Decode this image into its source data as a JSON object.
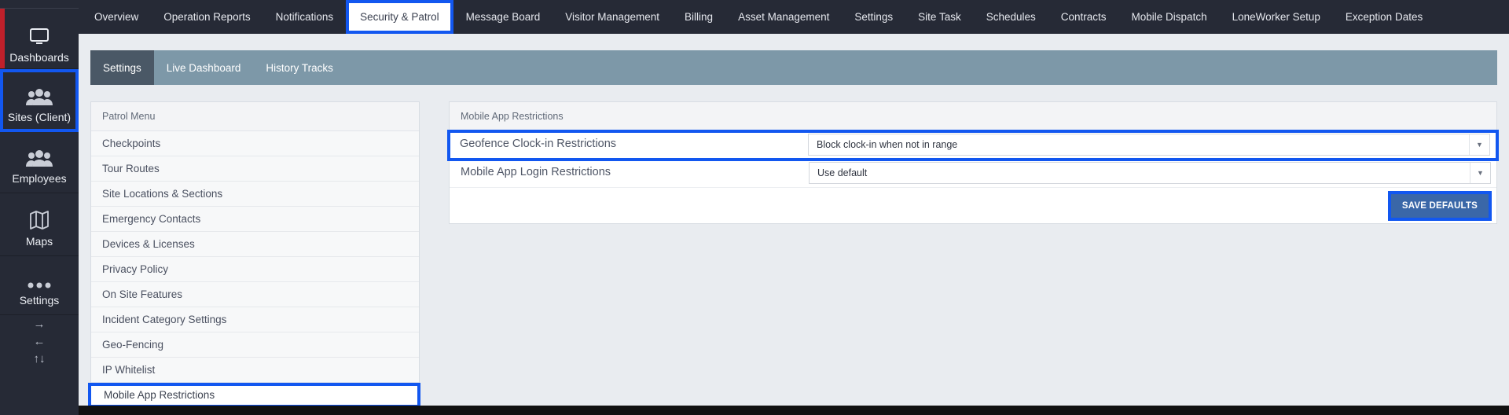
{
  "sidebar": {
    "items": [
      {
        "label": "Dashboards",
        "icon": "monitor-icon"
      },
      {
        "label": "Sites (Client)",
        "icon": "group-icon"
      },
      {
        "label": "Employees",
        "icon": "group-icon"
      },
      {
        "label": "Maps",
        "icon": "map-icon"
      },
      {
        "label": "Settings",
        "icon": "dots-icon"
      }
    ],
    "arrows": [
      "→",
      "←",
      "↑↓"
    ]
  },
  "topnav": {
    "tabs": [
      "Overview",
      "Operation Reports",
      "Notifications",
      "Security & Patrol",
      "Message Board",
      "Visitor Management",
      "Billing",
      "Asset Management",
      "Settings",
      "Site Task",
      "Schedules",
      "Contracts",
      "Mobile Dispatch",
      "LoneWorker Setup",
      "Exception Dates"
    ],
    "active": "Security & Patrol"
  },
  "subtabs": [
    "Settings",
    "Live Dashboard",
    "History Tracks"
  ],
  "patrol_menu": {
    "title": "Patrol Menu",
    "items": [
      "Checkpoints",
      "Tour Routes",
      "Site Locations & Sections",
      "Emergency Contacts",
      "Devices & Licenses",
      "Privacy Policy",
      "On Site Features",
      "Incident Category Settings",
      "Geo-Fencing",
      "IP Whitelist",
      "Mobile App Restrictions"
    ]
  },
  "restrictions": {
    "title": "Mobile App Restrictions",
    "geofence": {
      "label": "Geofence Clock-in Restrictions",
      "value": "Block clock-in when not in range"
    },
    "login": {
      "label": "Mobile App Login Restrictions",
      "value": "Use default"
    },
    "save_label": "SAVE DEFAULTS"
  },
  "colors": {
    "highlight": "#1257f0",
    "sidebar": "#262a36",
    "subbar": "#7d98a8",
    "accent_red": "#c0202b"
  }
}
